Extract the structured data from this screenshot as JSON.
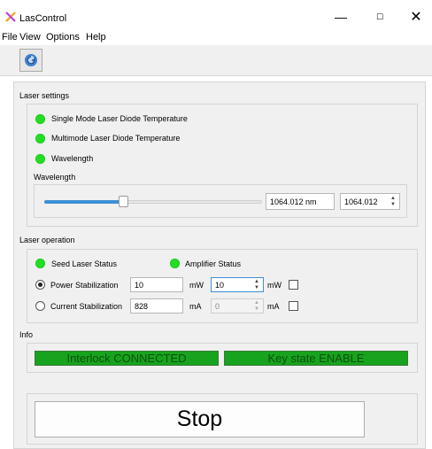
{
  "window": {
    "title": "LasControl",
    "controls": {
      "minimize": "—",
      "maximize": "☐",
      "close": "✕"
    }
  },
  "menu": [
    "File",
    "View",
    "Options",
    "Help"
  ],
  "laser_settings": {
    "label": "Laser settings",
    "indicators": [
      {
        "label": "Single Mode Laser Diode Temperature",
        "color": "#22dd22"
      },
      {
        "label": "Multimode Laser Diode Temperature",
        "color": "#22dd22"
      },
      {
        "label": "Wavelength",
        "color": "#22dd22"
      }
    ],
    "wavelength_label": "Wavelength",
    "wavelength_readout": "1064.012 nm",
    "wavelength_spin": "1064.012",
    "slider_fraction": 0.36
  },
  "laser_operation": {
    "label": "Laser operation",
    "seed_status": "Seed Laser Status",
    "amplifier_status": "Amplifier Status",
    "power": {
      "label": "Power Stabilization",
      "selected": true,
      "value": "10",
      "unit": "mW",
      "spin_value": "10",
      "spin_unit": "mW"
    },
    "current": {
      "label": "Current Stabilization",
      "selected": false,
      "value": "828",
      "unit": "mA",
      "spin_value": "0",
      "spin_unit": "mA"
    }
  },
  "info": {
    "label": "Info",
    "interlock": "Interlock CONNECTED",
    "key_state": "Key state ENABLE"
  },
  "stop_label": "Stop",
  "colors": {
    "led_green": "#22dd22",
    "status_green": "#17a31d",
    "accent": "#3d8fd6"
  }
}
